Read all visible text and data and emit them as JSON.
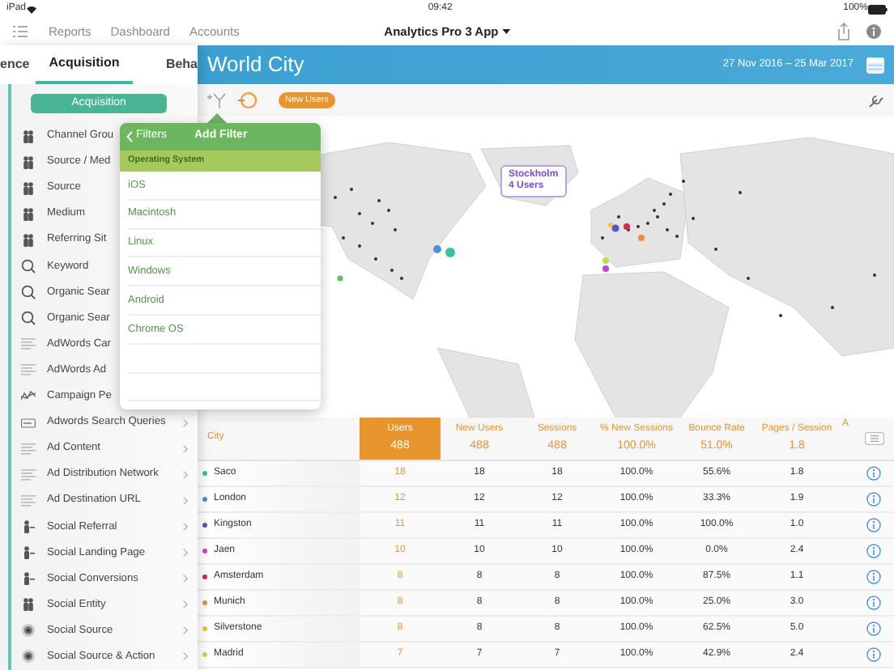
{
  "status_bar": {
    "device": "iPad",
    "time": "09:42",
    "battery": "100%"
  },
  "nav": {
    "links": [
      "Reports",
      "Dashboard",
      "Accounts"
    ],
    "title": "Analytics Pro 3 App"
  },
  "tabs": [
    {
      "label": "ence",
      "selected": false
    },
    {
      "label": "Acquisition",
      "selected": true
    },
    {
      "label": "Beha",
      "selected": false
    }
  ],
  "section_button": "Acquisition",
  "sidebar": {
    "items": [
      {
        "label": "Channel Grou",
        "kind": "people",
        "chevron": false
      },
      {
        "label": "Source / Med",
        "kind": "people",
        "chevron": false
      },
      {
        "label": "Source",
        "kind": "people",
        "chevron": false
      },
      {
        "label": "Medium",
        "kind": "people",
        "chevron": false
      },
      {
        "label": "Referring Sit",
        "kind": "people",
        "chevron": false
      },
      {
        "label": "Keyword",
        "kind": "search",
        "chevron": false
      },
      {
        "label": "Organic Sear",
        "kind": "search",
        "chevron": false
      },
      {
        "label": "Organic Sear",
        "kind": "search",
        "chevron": false
      },
      {
        "label": "AdWords Car",
        "kind": "text",
        "chevron": false
      },
      {
        "label": "AdWords Ad",
        "kind": "text",
        "chevron": false
      },
      {
        "label": "Campaign Pe",
        "kind": "campaign",
        "chevron": false
      },
      {
        "label": "Adwords Search Queries",
        "kind": "query",
        "chevron": true
      },
      {
        "label": "Ad Content",
        "kind": "text",
        "chevron": true
      },
      {
        "label": "Ad Distribution Network",
        "kind": "text",
        "chevron": true
      },
      {
        "label": "Ad Destination URL",
        "kind": "text",
        "chevron": true
      },
      {
        "label": "Social Referral",
        "kind": "social",
        "chevron": true
      },
      {
        "label": "Social Landing Page",
        "kind": "social",
        "chevron": true
      },
      {
        "label": "Social Conversions",
        "kind": "social",
        "chevron": true
      },
      {
        "label": "Social Entity",
        "kind": "people",
        "chevron": true
      },
      {
        "label": "Social Source",
        "kind": "globe",
        "chevron": true
      },
      {
        "label": "Social Source & Action",
        "kind": "globe",
        "chevron": true
      }
    ]
  },
  "header": {
    "title": "World City",
    "date_range": "27 Nov 2016 – 25 Mar 2017"
  },
  "toolbar": {
    "metric_badge": "New Users"
  },
  "popover": {
    "back": "Filters",
    "title": "Add Filter",
    "section": "Operating System",
    "options": [
      "iOS",
      "Macintosh",
      "Linux",
      "Windows",
      "Android",
      "Chrome OS"
    ]
  },
  "map_tooltip": {
    "city": "Stockholm",
    "count": "4 Users"
  },
  "table": {
    "columns": [
      {
        "label": "City",
        "selected": false
      },
      {
        "label": "Users",
        "selected": true
      },
      {
        "label": "New Users",
        "selected": false
      },
      {
        "label": "Sessions",
        "selected": false
      },
      {
        "label": "% New Sessions",
        "selected": false
      },
      {
        "label": "Bounce Rate",
        "selected": false
      },
      {
        "label": "Pages / Session",
        "selected": false
      },
      {
        "label": "A",
        "selected": false
      }
    ],
    "totals": [
      "488",
      "488",
      "488",
      "100.0%",
      "51.0%",
      "1.8"
    ],
    "rows": [
      {
        "city": "Saco",
        "color": "#3bbfa0",
        "values": [
          "18",
          "18",
          "18",
          "100.0%",
          "55.6%",
          "1.8"
        ]
      },
      {
        "city": "London",
        "color": "#4a90e2",
        "values": [
          "12",
          "12",
          "12",
          "100.0%",
          "33.3%",
          "1.9"
        ]
      },
      {
        "city": "Kingston",
        "color": "#5b4fd6",
        "values": [
          "11",
          "11",
          "11",
          "100.0%",
          "100.0%",
          "1.0"
        ]
      },
      {
        "city": "Jaen",
        "color": "#d23fd2",
        "values": [
          "10",
          "10",
          "10",
          "100.0%",
          "0.0%",
          "2.4"
        ]
      },
      {
        "city": "Amsterdam",
        "color": "#d6264a",
        "values": [
          "8",
          "8",
          "8",
          "100.0%",
          "87.5%",
          "1.1"
        ]
      },
      {
        "city": "Munich",
        "color": "#f08a3c",
        "values": [
          "8",
          "8",
          "8",
          "100.0%",
          "25.0%",
          "3.0"
        ]
      },
      {
        "city": "Silverstone",
        "color": "#f0c830",
        "values": [
          "8",
          "8",
          "8",
          "100.0%",
          "62.5%",
          "5.0"
        ]
      },
      {
        "city": "Madrid",
        "color": "#b8e04a",
        "values": [
          "7",
          "7",
          "7",
          "100.0%",
          "42.9%",
          "2.4"
        ]
      }
    ]
  }
}
